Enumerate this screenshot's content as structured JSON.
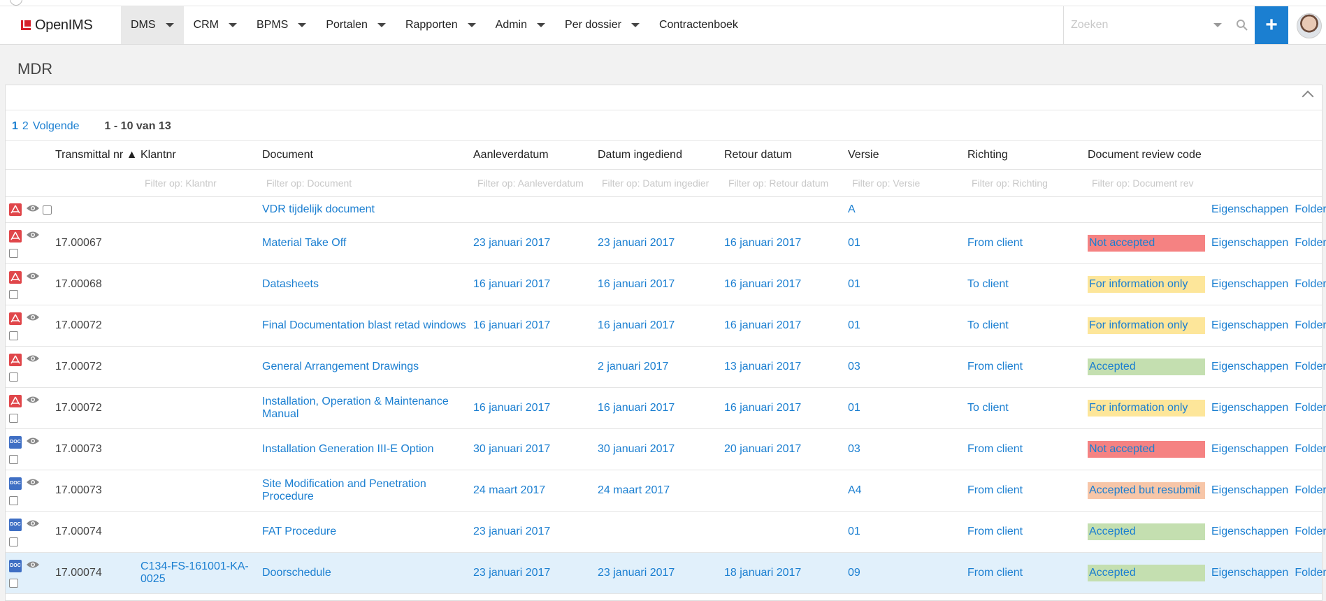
{
  "app": {
    "logo_text": "OpenIMS"
  },
  "nav": [
    {
      "label": "DMS",
      "active": true,
      "dropdown": true
    },
    {
      "label": "CRM",
      "dropdown": true
    },
    {
      "label": "BPMS",
      "dropdown": true
    },
    {
      "label": "Portalen",
      "dropdown": true
    },
    {
      "label": "Rapporten",
      "dropdown": true
    },
    {
      "label": "Admin",
      "dropdown": true
    },
    {
      "label": "Per dossier",
      "dropdown": true
    },
    {
      "label": "Contractenboek",
      "dropdown": false
    }
  ],
  "search": {
    "placeholder": "Zoeken"
  },
  "page": {
    "title": "MDR"
  },
  "pager": {
    "pages": [
      "1",
      "2"
    ],
    "next": "Volgende",
    "count": "1 - 10 van 13"
  },
  "columns": {
    "transmittal": "Transmittal nr ▲",
    "klantnr": "Klantnr",
    "document": "Document",
    "aanleverdatum": "Aanleverdatum",
    "datum_ingediend": "Datum ingediend",
    "retour_datum": "Retour datum",
    "versie": "Versie",
    "richting": "Richting",
    "review_code": "Document review code"
  },
  "filters": {
    "klantnr": "Filter op: Klantnr",
    "document": "Filter op: Document",
    "aanleverdatum": "Filter op: Aanleverdatum",
    "datum_ingediend": "Filter op: Datum ingedier",
    "retour_datum": "Filter op: Retour datum",
    "versie": "Filter op: Versie",
    "richting": "Filter op: Richting",
    "review_code": "Filter op: Document rev"
  },
  "actions": {
    "properties": "Eigenschappen",
    "folder": "Folder"
  },
  "review_colors": {
    "Not accepted": "#f58282",
    "For information only": "#fde69a",
    "Accepted": "#c4dfb0",
    "Accepted but resubmit": "#f7c6a8"
  },
  "rows": [
    {
      "type": "pdf",
      "transmittal": "",
      "klantnr": "",
      "document": "VDR tijdelijk document",
      "aanleverdatum": "",
      "datum_ingediend": "",
      "retour_datum": "",
      "versie": "A",
      "richting": "",
      "review_code": ""
    },
    {
      "type": "pdf",
      "transmittal": "17.00067",
      "klantnr": "",
      "document": "Material Take Off",
      "aanleverdatum": "23 januari 2017",
      "datum_ingediend": "23 januari 2017",
      "retour_datum": "16 januari 2017",
      "versie": "01",
      "richting": "From client",
      "review_code": "Not accepted"
    },
    {
      "type": "pdf",
      "transmittal": "17.00068",
      "klantnr": "",
      "document": "Datasheets",
      "aanleverdatum": "16 januari 2017",
      "datum_ingediend": "16 januari 2017",
      "retour_datum": "16 januari 2017",
      "versie": "01",
      "richting": "To client",
      "review_code": "For information only"
    },
    {
      "type": "pdf",
      "transmittal": "17.00072",
      "klantnr": "",
      "document": "Final Documentation blast retad windows",
      "aanleverdatum": "16 januari 2017",
      "datum_ingediend": "16 januari 2017",
      "retour_datum": "16 januari 2017",
      "versie": "01",
      "richting": "To client",
      "review_code": "For information only"
    },
    {
      "type": "pdf",
      "transmittal": "17.00072",
      "klantnr": "",
      "document": "General Arrangement Drawings",
      "aanleverdatum": "",
      "datum_ingediend": "2 januari 2017",
      "retour_datum": "13 januari 2017",
      "versie": "03",
      "richting": "From client",
      "review_code": "Accepted"
    },
    {
      "type": "pdf",
      "transmittal": "17.00072",
      "klantnr": "",
      "document": "Installation, Operation & Maintenance Manual",
      "aanleverdatum": "16 januari 2017",
      "datum_ingediend": "16 januari 2017",
      "retour_datum": "16 januari 2017",
      "versie": "01",
      "richting": "To client",
      "review_code": "For information only"
    },
    {
      "type": "doc",
      "transmittal": "17.00073",
      "klantnr": "",
      "document": "Installation Generation III-E Option",
      "aanleverdatum": "30 januari 2017",
      "datum_ingediend": "30 januari 2017",
      "retour_datum": "20 januari 2017",
      "versie": "03",
      "richting": "From client",
      "review_code": "Not accepted"
    },
    {
      "type": "doc",
      "transmittal": "17.00073",
      "klantnr": "",
      "document": "Site Modification and Penetration Procedure",
      "aanleverdatum": "24 maart 2017",
      "datum_ingediend": "24 maart 2017",
      "retour_datum": "",
      "versie": "A4",
      "richting": "From client",
      "review_code": "Accepted but resubmit"
    },
    {
      "type": "doc",
      "transmittal": "17.00074",
      "klantnr": "",
      "document": "FAT Procedure",
      "aanleverdatum": "23 januari 2017",
      "datum_ingediend": "",
      "retour_datum": "",
      "versie": "01",
      "richting": "From client",
      "review_code": "Accepted"
    },
    {
      "type": "doc",
      "transmittal": "17.00074",
      "klantnr": "C134-FS-161001-KA-0025",
      "document": "Doorschedule",
      "aanleverdatum": "23 januari 2017",
      "datum_ingediend": "23 januari 2017",
      "retour_datum": "18 januari 2017",
      "versie": "09",
      "richting": "From client",
      "review_code": "Accepted",
      "selected": true
    }
  ]
}
